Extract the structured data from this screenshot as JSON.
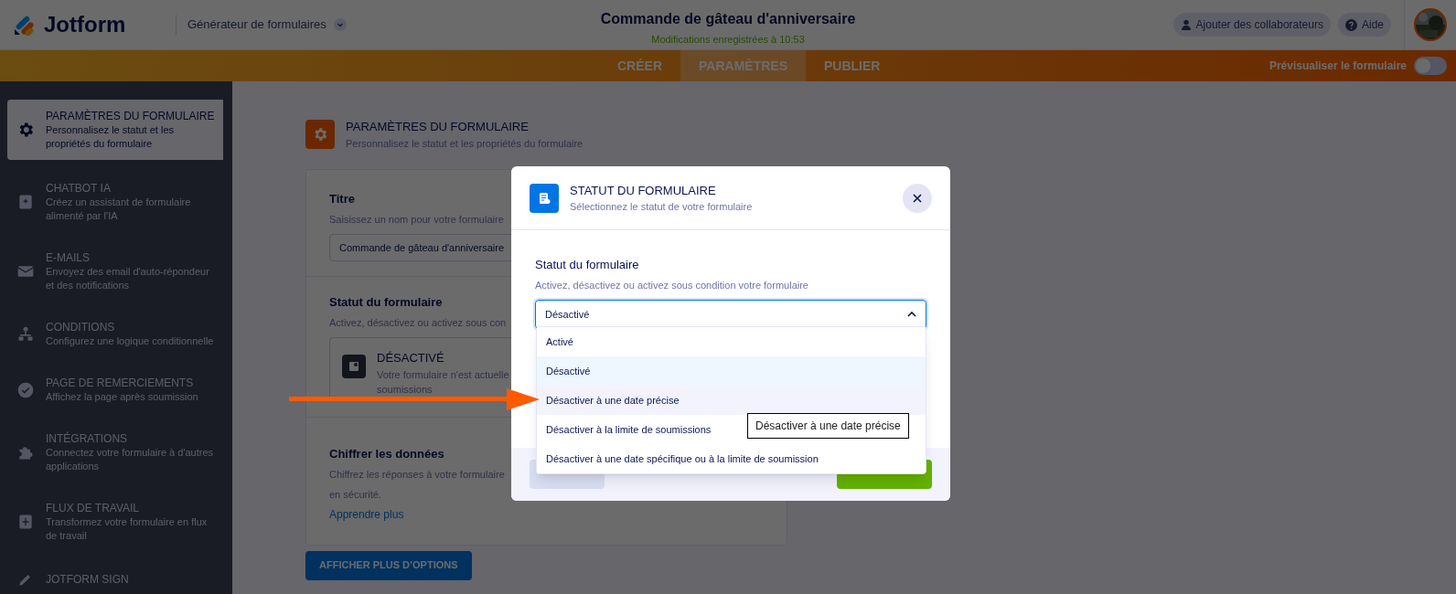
{
  "header": {
    "brand": "Jotform",
    "app_menu": "Générateur de formulaires",
    "form_title": "Commande de gâteau d'anniversaire",
    "save_status": "Modifications enregistrées à 10:53",
    "buttons": [
      {
        "kind": "user",
        "label": "Ajouter des collaborateurs"
      },
      {
        "kind": "help",
        "label": "Aide"
      }
    ]
  },
  "tabs": [
    {
      "label": "CRÉER",
      "selected": false
    },
    {
      "label": "PARAMÈTRES",
      "selected": true
    },
    {
      "label": "PUBLIER",
      "selected": false
    }
  ],
  "preview": {
    "label": "Prévisualiser le formulaire",
    "on": false
  },
  "sidebar": {
    "items": [
      {
        "kind": "gear",
        "title": "PARAMÈTRES DU FORMULAIRE",
        "description": "Personnalisez le statut et les propriétés du formulaire",
        "selected": true
      },
      {
        "kind": "sparkle",
        "title": "CHATBOT IA",
        "description": "Créez un assistant de formulaire alimenté par l'IA",
        "selected": false
      },
      {
        "kind": "mail",
        "title": "E-MAILS",
        "description": "Envoyez des email d'auto-répondeur et des notifications",
        "selected": false
      },
      {
        "kind": "tree",
        "title": "CONDITIONS",
        "description": "Configurez une logique conditionnelle",
        "selected": false
      },
      {
        "kind": "check",
        "title": "PAGE DE REMERCIEMENTS",
        "description": "Affichez la page après soumission",
        "selected": false
      },
      {
        "kind": "puzzle",
        "title": "INTÉGRATIONS",
        "description": "Connectez votre formulaire à d'autres applications",
        "selected": false
      },
      {
        "kind": "flow",
        "title": "FLUX DE TRAVAIL",
        "description": "Transformez votre formulaire en flux de travail",
        "selected": false
      },
      {
        "kind": "sign",
        "title": "JOTFORM SIGN",
        "selected": false
      }
    ]
  },
  "section": {
    "title": "PARAMÈTRES DU FORMULAIRE",
    "subtitle": "Personnalisez le statut et les propriétés du formulaire"
  },
  "title_card": {
    "label": "Titre",
    "hint": "Saisissez un nom pour votre formulaire",
    "value": "Commande de gâteau d'anniversaire"
  },
  "status_card": {
    "label": "Statut du formulaire",
    "hint": "Activez, désactivez ou activez sous con",
    "status_title": "DÉSACTIVÉ",
    "status_lines": [
      "Votre formulaire n'est actuelle",
      "soumissions"
    ]
  },
  "encrypt_card": {
    "label": "Chiffrer les données",
    "lines": [
      "Chiffrez les réponses à votre formulaire",
      "en sécurité."
    ],
    "link": "Apprendre plus"
  },
  "more_button": "AFFICHER PLUS D’OPTIONS",
  "modal": {
    "title": "STATUT DU FORMULAIRE",
    "subtitle": "Sélectionnez le statut de votre formulaire",
    "field_label": "Statut du formulaire",
    "field_hint": "Activez, désactivez ou activez sous condition votre formulaire",
    "value": "Désactivé",
    "expanded": true,
    "options": [
      {
        "label": "Activé",
        "selected": false,
        "hovered": false
      },
      {
        "label": "Désactivé",
        "selected": true,
        "hovered": false
      },
      {
        "label": "Désactiver à une date précise",
        "selected": false,
        "hovered": true
      },
      {
        "label": "Désactiver à la limite de soumissions",
        "selected": false,
        "hovered": false
      },
      {
        "label": "Désactiver à une date spécifique ou à la limite de soumission",
        "selected": false,
        "hovered": false
      }
    ],
    "tooltip": "Désactiver à une date précise",
    "buttons": [
      {
        "kind": "secondary"
      },
      {
        "kind": "primary"
      }
    ]
  }
}
